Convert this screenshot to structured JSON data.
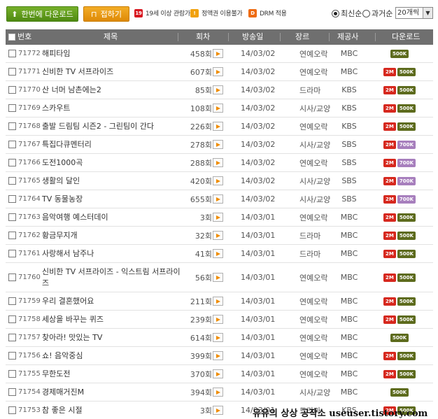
{
  "toolbar": {
    "download_all_label": "한번에 다운로드",
    "fold_label": "접하기",
    "legend": [
      {
        "badge": "19",
        "text": "19세 이상 관람가",
        "icon": "age-19-icon",
        "color": "#d8161f"
      },
      {
        "badge": "!",
        "text": "정액권 이용불가",
        "icon": "warning-icon",
        "color": "#f1a10d"
      },
      {
        "badge": "D",
        "text": "DRM 적용",
        "icon": "drm-icon",
        "color": "#ee6b12"
      }
    ],
    "sort_newest": "최신순",
    "sort_oldest": "과거순",
    "per_page": "20개씩"
  },
  "table": {
    "headers": {
      "number": "번호",
      "title": "제목",
      "episode": "회차",
      "air_date": "방송일",
      "genre": "장르",
      "station": "제공사",
      "download": "다운로드"
    },
    "rows": [
      {
        "number": "71772",
        "title": "해피타임",
        "episode": "458회",
        "date": "14/03/02",
        "genre": "연예오락",
        "station": "MBC",
        "badges": [
          "500K"
        ]
      },
      {
        "number": "71771",
        "title": "신비한 TV 서프라이즈",
        "episode": "607회",
        "date": "14/03/02",
        "genre": "연예오락",
        "station": "MBC",
        "badges": [
          "2M",
          "500K"
        ]
      },
      {
        "number": "71770",
        "title": "산 너머 남촌에는2",
        "episode": "85회",
        "date": "14/03/02",
        "genre": "드라마",
        "station": "KBS",
        "badges": [
          "2M",
          "500K"
        ]
      },
      {
        "number": "71769",
        "title": "스카우트",
        "episode": "108회",
        "date": "14/03/02",
        "genre": "시사/교양",
        "station": "KBS",
        "badges": [
          "2M",
          "500K"
        ]
      },
      {
        "number": "71768",
        "title": "출발 드림팀 시즌2 - 그린팀이 간다",
        "episode": "226회",
        "date": "14/03/02",
        "genre": "연예오락",
        "station": "KBS",
        "badges": [
          "2M",
          "500K"
        ]
      },
      {
        "number": "71767",
        "title": "특집다큐멘터리",
        "episode": "278회",
        "date": "14/03/02",
        "genre": "시사/교양",
        "station": "SBS",
        "badges": [
          "2M",
          "700K"
        ]
      },
      {
        "number": "71766",
        "title": "도전1000곡",
        "episode": "288회",
        "date": "14/03/02",
        "genre": "연예오락",
        "station": "SBS",
        "badges": [
          "2M",
          "700K"
        ]
      },
      {
        "number": "71765",
        "title": "생활의 달인",
        "episode": "420회",
        "date": "14/03/02",
        "genre": "시사/교양",
        "station": "SBS",
        "badges": [
          "2M",
          "700K"
        ]
      },
      {
        "number": "71764",
        "title": "TV 동물농장",
        "episode": "655회",
        "date": "14/03/02",
        "genre": "시사/교양",
        "station": "SBS",
        "badges": [
          "2M",
          "700K"
        ]
      },
      {
        "number": "71763",
        "title": "음악여행 예스터데이",
        "episode": "3회",
        "date": "14/03/01",
        "genre": "연예오락",
        "station": "MBC",
        "badges": [
          "2M",
          "500K"
        ]
      },
      {
        "number": "71762",
        "title": "황금무지개",
        "episode": "32회",
        "date": "14/03/01",
        "genre": "드라마",
        "station": "MBC",
        "badges": [
          "2M",
          "500K"
        ]
      },
      {
        "number": "71761",
        "title": "사랑해서 남주나",
        "episode": "41회",
        "date": "14/03/01",
        "genre": "드라마",
        "station": "MBC",
        "badges": [
          "2M",
          "500K"
        ]
      },
      {
        "number": "71760",
        "title": "신비한 TV 서프라이즈 - 익스트림 서프라이즈",
        "episode": "56회",
        "date": "14/03/01",
        "genre": "연예오락",
        "station": "MBC",
        "badges": [
          "2M",
          "500K"
        ]
      },
      {
        "number": "71759",
        "title": "우리 결혼했어요",
        "episode": "211회",
        "date": "14/03/01",
        "genre": "연예오락",
        "station": "MBC",
        "badges": [
          "2M",
          "500K"
        ]
      },
      {
        "number": "71758",
        "title": "세상을 바꾸는 퀴즈",
        "episode": "239회",
        "date": "14/03/01",
        "genre": "연예오락",
        "station": "MBC",
        "badges": [
          "2M",
          "500K"
        ]
      },
      {
        "number": "71757",
        "title": "찾아라! 맛있는 TV",
        "episode": "614회",
        "date": "14/03/01",
        "genre": "연예오락",
        "station": "MBC",
        "badges": [
          "500K"
        ]
      },
      {
        "number": "71756",
        "title": "쇼! 음악중심",
        "episode": "399회",
        "date": "14/03/01",
        "genre": "연예오락",
        "station": "MBC",
        "badges": [
          "2M",
          "500K"
        ]
      },
      {
        "number": "71755",
        "title": "무한도전",
        "episode": "370회",
        "date": "14/03/01",
        "genre": "연예오락",
        "station": "MBC",
        "badges": [
          "2M",
          "500K"
        ]
      },
      {
        "number": "71754",
        "title": "경제매거진M",
        "episode": "394회",
        "date": "14/03/01",
        "genre": "시사/교양",
        "station": "MBC",
        "badges": [
          "500K"
        ]
      },
      {
        "number": "71753",
        "title": "참 좋은 시절",
        "episode": "3회",
        "date": "14/03/01",
        "genre": "드라마",
        "station": "KBS",
        "badges": [
          "2M",
          "500K"
        ]
      }
    ]
  },
  "watermark": "유유의 상상 공작소  useuser.tistory.com",
  "colors": {
    "header_bg": "#6f6f6f",
    "download_btn": "#5f9c1b",
    "fold_btn": "#ea9a12",
    "badge_2m": "#d6281e",
    "badge_500k": "#5d6b1d",
    "badge_700k": "#a77fbd"
  }
}
